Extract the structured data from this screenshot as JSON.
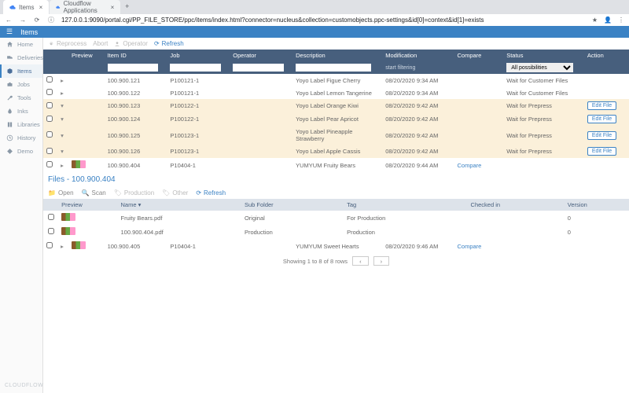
{
  "browser": {
    "tabs": [
      {
        "label": "Items",
        "active": true
      },
      {
        "label": "Cloudflow Applications",
        "active": false
      }
    ],
    "address": "127.0.0.1:9090/portal.cgi/PP_FILE_STORE/ppc/items/index.html?connector=nucleus&collection=customobjects.ppc-settings&id[0]=context&id[1]=exists"
  },
  "appHeader": {
    "title": "Items"
  },
  "sidebar": {
    "items": [
      {
        "label": "Home"
      },
      {
        "label": "Deliveries"
      },
      {
        "label": "Items"
      },
      {
        "label": "Jobs"
      },
      {
        "label": "Tools"
      },
      {
        "label": "Inks"
      },
      {
        "label": "Libraries"
      },
      {
        "label": "History"
      },
      {
        "label": "Demo"
      }
    ],
    "footer": "CLOUDFLOW"
  },
  "itemsToolbar": {
    "reprocess": "Reprocess",
    "abort": "Abort",
    "operator": "Operator",
    "refresh": "Refresh"
  },
  "itemsTable": {
    "cols": {
      "preview": "Preview",
      "itemId": "Item ID",
      "job": "Job",
      "operator": "Operator",
      "description": "Description",
      "modification": "Modification",
      "compare": "Compare",
      "status": "Status",
      "action": "Action"
    },
    "filterHint": "start filtering",
    "statusFilterSelected": "All possibilities"
  },
  "rows": [
    {
      "id": "100.900.121",
      "job": "P100121-1",
      "desc": "Yoyo Label Figue Cherry",
      "mod": "08/20/2020 9:34 AM",
      "compare": "",
      "status": "Wait for Customer Files",
      "action": "",
      "selected": false,
      "thumb": false
    },
    {
      "id": "100.900.122",
      "job": "P100121-1",
      "desc": "Yoyo Label Lemon Tangerine",
      "mod": "08/20/2020 9:34 AM",
      "compare": "",
      "status": "Wait for Customer Files",
      "action": "",
      "selected": false,
      "thumb": false
    },
    {
      "id": "100.900.123",
      "job": "P100122-1",
      "desc": "Yoyo Label Orange Kiwi",
      "mod": "08/20/2020 9:42 AM",
      "compare": "",
      "status": "Wait for Prepress",
      "action": "Edit File",
      "selected": true,
      "thumb": false
    },
    {
      "id": "100.900.124",
      "job": "P100122-1",
      "desc": "Yoyo Label Pear Apricot",
      "mod": "08/20/2020 9:42 AM",
      "compare": "",
      "status": "Wait for Prepress",
      "action": "Edit File",
      "selected": true,
      "thumb": false
    },
    {
      "id": "100.900.125",
      "job": "P100123-1",
      "desc": "Yoyo Label Pineapple Strawberry",
      "mod": "08/20/2020 9:42 AM",
      "compare": "",
      "status": "Wait for Prepress",
      "action": "Edit File",
      "selected": true,
      "thumb": false
    },
    {
      "id": "100.900.126",
      "job": "P100123-1",
      "desc": "Yoyo Label Apple Cassis",
      "mod": "08/20/2020 9:42 AM",
      "compare": "",
      "status": "Wait for Prepress",
      "action": "Edit File",
      "selected": true,
      "thumb": false
    },
    {
      "id": "100.900.404",
      "job": "P10404-1",
      "desc": "YUMYUM Fruity Bears",
      "mod": "08/20/2020 9:44 AM",
      "compare": "Compare",
      "status": "",
      "action": "",
      "selected": false,
      "thumb": true
    }
  ],
  "filesPanel": {
    "title": "Files - 100.900.404",
    "toolbar": {
      "open": "Open",
      "scan": "Scan",
      "production": "Production",
      "other": "Other",
      "refresh": "Refresh"
    },
    "cols": {
      "preview": "Preview",
      "name": "Name",
      "subfolder": "Sub Folder",
      "tag": "Tag",
      "checkedIn": "Checked in",
      "version": "Version"
    },
    "sortIndicator": "▾",
    "rows": [
      {
        "name": "Fruity Bears.pdf",
        "subfolder": "Original",
        "tag": "For Production",
        "checkedIn": "",
        "version": "0"
      },
      {
        "name": "100.900.404.pdf",
        "subfolder": "Production",
        "tag": "Production",
        "checkedIn": "",
        "version": "0"
      }
    ]
  },
  "rows2": [
    {
      "id": "100.900.405",
      "job": "P10404-1",
      "desc": "YUMYUM Sweet Hearts",
      "mod": "08/20/2020 9:46 AM",
      "compare": "Compare",
      "status": "",
      "action": "",
      "thumb": true
    }
  ],
  "pager": {
    "summary": "Showing 1 to 8 of 8 rows",
    "prev": "‹",
    "next": "›"
  },
  "icons": {
    "cloud": "☁",
    "close": "×",
    "plus": "+",
    "back": "←",
    "fwd": "→",
    "reload": "⟳",
    "menu": "☰",
    "refresh": "⟳",
    "gear": "⚙",
    "user": "👤",
    "folder": "📁",
    "star": "★"
  }
}
